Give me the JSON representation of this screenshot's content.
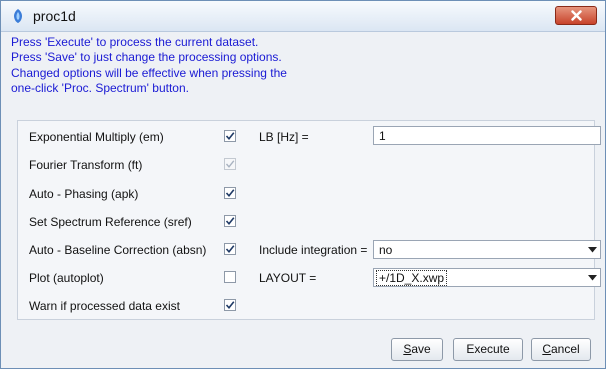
{
  "window": {
    "title": "proc1d",
    "app_icon": "app-logo-icon",
    "close_icon": "close-icon",
    "close_color": "#c7432b"
  },
  "info_lines": [
    "Press 'Execute' to process the current dataset.",
    "Press 'Save' to just change the processing options.",
    "Changed options will be effective when pressing the",
    "one-click 'Proc. Spectrum' button."
  ],
  "info_color": "#1a1ad4",
  "options": [
    {
      "label": "Exponential Multiply (em)",
      "checked": true,
      "enabled": true
    },
    {
      "label": "Fourier Transform (ft)",
      "checked": true,
      "enabled": false
    },
    {
      "label": "Auto - Phasing (apk)",
      "checked": true,
      "enabled": true
    },
    {
      "label": "Set Spectrum Reference (sref)",
      "checked": true,
      "enabled": true
    },
    {
      "label": "Auto - Baseline Correction (absn)",
      "checked": true,
      "enabled": true
    },
    {
      "label": "Plot (autoplot)",
      "checked": false,
      "enabled": true
    },
    {
      "label": "Warn if processed data exist",
      "checked": true,
      "enabled": true
    }
  ],
  "lb": {
    "label": "LB [Hz] =",
    "value": "1"
  },
  "include_integration": {
    "label": "Include integration =",
    "selected": "no"
  },
  "layout": {
    "label": "LAYOUT =",
    "selected": "+/1D_X.xwp"
  },
  "buttons": {
    "save": {
      "mnemonic": "S",
      "rest": "ave"
    },
    "execute": {
      "label": "Execute"
    },
    "cancel": {
      "mnemonic": "C",
      "rest": "ancel"
    }
  }
}
